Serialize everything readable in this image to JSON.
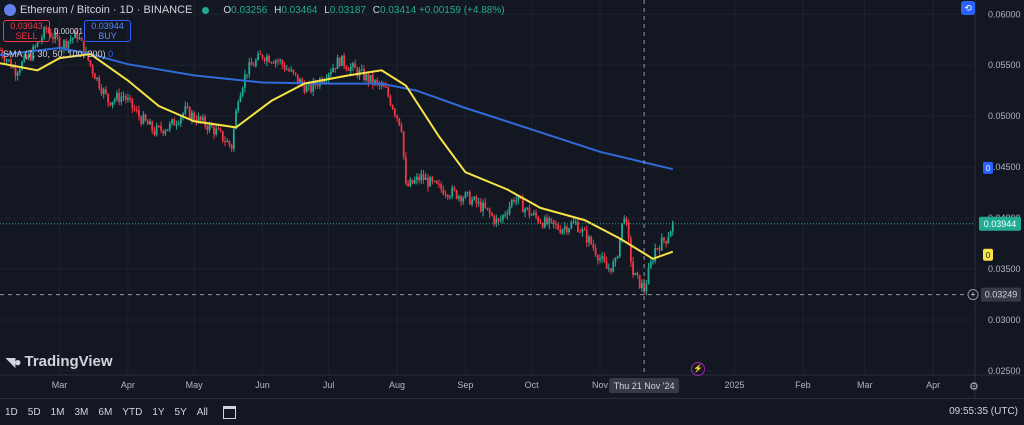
{
  "header": {
    "title": "Ethereum / Bitcoin · 1D · BINANCE",
    "ohlc": [
      {
        "label": "O",
        "value": "0.03256"
      },
      {
        "label": "H",
        "value": "0.03464"
      },
      {
        "label": "L",
        "value": "0.03187"
      },
      {
        "label": "C",
        "value": "0.03414"
      },
      {
        "label": "",
        "value": "+0.00159 (+4.88%)"
      }
    ]
  },
  "trade": {
    "sell_price": "0.03943",
    "sell_label": "SELL",
    "buy_price": "0.03944",
    "buy_label": "BUY",
    "spread": "0.00001"
  },
  "indicator": {
    "label": "SMA (7, 30, 50, 100, 200)",
    "value": "0"
  },
  "logo_text": "TradingView",
  "timeframes": [
    "1D",
    "5D",
    "1M",
    "3M",
    "6M",
    "YTD",
    "1Y",
    "5Y",
    "All"
  ],
  "clock": "09:55:35 (UTC)",
  "colors": {
    "up": "#22ab94",
    "down": "#f23645",
    "sma_short": "#f7e345",
    "sma_long": "#2f6bd9",
    "background": "#131722"
  },
  "chart_data": {
    "type": "candlestick",
    "y_range": [
      0.0246,
      0.0614
    ],
    "y_ticks": [
      "0.06000",
      "0.05500",
      "0.05000",
      "0.04500",
      "0.04000",
      "0.03500",
      "0.03000",
      "0.02500"
    ],
    "x_range": [
      "2024-02-03",
      "2025-04-20"
    ],
    "x_ticks": [
      {
        "date": "2024-03-01",
        "label": "Mar"
      },
      {
        "date": "2024-04-01",
        "label": "Apr"
      },
      {
        "date": "2024-05-01",
        "label": "May"
      },
      {
        "date": "2024-06-01",
        "label": "Jun"
      },
      {
        "date": "2024-07-01",
        "label": "Jul"
      },
      {
        "date": "2024-08-01",
        "label": "Aug"
      },
      {
        "date": "2024-09-01",
        "label": "Sep"
      },
      {
        "date": "2024-10-01",
        "label": "Oct"
      },
      {
        "date": "2024-11-01",
        "label": "Nov"
      },
      {
        "date": "2025-01-01",
        "label": "2025"
      },
      {
        "date": "2025-02-01",
        "label": "Feb"
      },
      {
        "date": "2025-03-01",
        "label": "Mar"
      },
      {
        "date": "2025-04-01",
        "label": "Apr"
      }
    ],
    "close_path": [
      {
        "date": "2024-02-03",
        "close": 0.0565
      },
      {
        "date": "2024-02-10",
        "close": 0.0545
      },
      {
        "date": "2024-02-17",
        "close": 0.056
      },
      {
        "date": "2024-02-24",
        "close": 0.0585
      },
      {
        "date": "2024-03-02",
        "close": 0.057
      },
      {
        "date": "2024-03-09",
        "close": 0.058
      },
      {
        "date": "2024-03-16",
        "close": 0.0545
      },
      {
        "date": "2024-03-23",
        "close": 0.0515
      },
      {
        "date": "2024-03-30",
        "close": 0.052
      },
      {
        "date": "2024-04-06",
        "close": 0.05
      },
      {
        "date": "2024-04-13",
        "close": 0.0485
      },
      {
        "date": "2024-04-20",
        "close": 0.049
      },
      {
        "date": "2024-04-27",
        "close": 0.0505
      },
      {
        "date": "2024-05-04",
        "close": 0.0495
      },
      {
        "date": "2024-05-11",
        "close": 0.0485
      },
      {
        "date": "2024-05-18",
        "close": 0.047
      },
      {
        "date": "2024-05-21",
        "close": 0.052
      },
      {
        "date": "2024-05-25",
        "close": 0.0545
      },
      {
        "date": "2024-06-01",
        "close": 0.056
      },
      {
        "date": "2024-06-08",
        "close": 0.0555
      },
      {
        "date": "2024-06-15",
        "close": 0.054
      },
      {
        "date": "2024-06-22",
        "close": 0.0525
      },
      {
        "date": "2024-06-29",
        "close": 0.054
      },
      {
        "date": "2024-07-06",
        "close": 0.0555
      },
      {
        "date": "2024-07-13",
        "close": 0.0545
      },
      {
        "date": "2024-07-20",
        "close": 0.0535
      },
      {
        "date": "2024-07-27",
        "close": 0.0525
      },
      {
        "date": "2024-08-03",
        "close": 0.049
      },
      {
        "date": "2024-08-05",
        "close": 0.043
      },
      {
        "date": "2024-08-12",
        "close": 0.044
      },
      {
        "date": "2024-08-19",
        "close": 0.043
      },
      {
        "date": "2024-08-26",
        "close": 0.0425
      },
      {
        "date": "2024-09-02",
        "close": 0.042
      },
      {
        "date": "2024-09-09",
        "close": 0.041
      },
      {
        "date": "2024-09-16",
        "close": 0.0395
      },
      {
        "date": "2024-09-23",
        "close": 0.042
      },
      {
        "date": "2024-09-30",
        "close": 0.0405
      },
      {
        "date": "2024-10-07",
        "close": 0.0395
      },
      {
        "date": "2024-10-14",
        "close": 0.039
      },
      {
        "date": "2024-10-21",
        "close": 0.0395
      },
      {
        "date": "2024-10-28",
        "close": 0.0375
      },
      {
        "date": "2024-11-04",
        "close": 0.035
      },
      {
        "date": "2024-11-08",
        "close": 0.0355
      },
      {
        "date": "2024-11-12",
        "close": 0.0405
      },
      {
        "date": "2024-11-16",
        "close": 0.0345
      },
      {
        "date": "2024-11-21",
        "close": 0.033
      },
      {
        "date": "2024-11-26",
        "close": 0.037
      },
      {
        "date": "2024-12-01",
        "close": 0.038
      },
      {
        "date": "2024-12-04",
        "close": 0.0394
      }
    ],
    "series": [
      {
        "name": "",
        "color": "#2f6bd9",
        "points": [
          {
            "date": "2024-02-03",
            "value": 0.056
          },
          {
            "date": "2024-03-01",
            "value": 0.0567
          },
          {
            "date": "2024-03-15",
            "value": 0.0561
          },
          {
            "date": "2024-04-01",
            "value": 0.0551
          },
          {
            "date": "2024-05-01",
            "value": 0.054
          },
          {
            "date": "2024-06-01",
            "value": 0.0533
          },
          {
            "date": "2024-07-01",
            "value": 0.0532
          },
          {
            "date": "2024-07-25",
            "value": 0.0532
          },
          {
            "date": "2024-08-10",
            "value": 0.0525
          },
          {
            "date": "2024-09-01",
            "value": 0.0508
          },
          {
            "date": "2024-10-01",
            "value": 0.0487
          },
          {
            "date": "2024-11-01",
            "value": 0.0465
          },
          {
            "date": "2024-12-04",
            "value": 0.0448
          }
        ]
      },
      {
        "name": "",
        "color": "#f7e345",
        "points": [
          {
            "date": "2024-02-03",
            "value": 0.0552
          },
          {
            "date": "2024-02-20",
            "value": 0.0545
          },
          {
            "date": "2024-03-01",
            "value": 0.0557
          },
          {
            "date": "2024-03-15",
            "value": 0.0561
          },
          {
            "date": "2024-04-01",
            "value": 0.0535
          },
          {
            "date": "2024-04-15",
            "value": 0.051
          },
          {
            "date": "2024-05-01",
            "value": 0.0495
          },
          {
            "date": "2024-05-20",
            "value": 0.0489
          },
          {
            "date": "2024-06-05",
            "value": 0.0515
          },
          {
            "date": "2024-06-20",
            "value": 0.0532
          },
          {
            "date": "2024-07-10",
            "value": 0.054
          },
          {
            "date": "2024-07-25",
            "value": 0.0545
          },
          {
            "date": "2024-08-05",
            "value": 0.053
          },
          {
            "date": "2024-08-20",
            "value": 0.048
          },
          {
            "date": "2024-09-01",
            "value": 0.0445
          },
          {
            "date": "2024-09-20",
            "value": 0.0428
          },
          {
            "date": "2024-10-05",
            "value": 0.041
          },
          {
            "date": "2024-10-25",
            "value": 0.0398
          },
          {
            "date": "2024-11-10",
            "value": 0.038
          },
          {
            "date": "2024-11-25",
            "value": 0.036
          },
          {
            "date": "2024-12-04",
            "value": 0.0367
          }
        ]
      }
    ],
    "price_labels": [
      {
        "value": 0.04492,
        "text": "0",
        "kind": "blue"
      },
      {
        "value": 0.03944,
        "text": "0.03944",
        "kind": "green"
      },
      {
        "value": 0.0364,
        "text": "0",
        "kind": "yellow"
      },
      {
        "value": 0.03249,
        "text": "0.03249",
        "kind": "cross"
      }
    ],
    "crosshair": {
      "date": "2024-11-21",
      "value": 0.03249,
      "label": "Thu 21 Nov '24"
    }
  }
}
